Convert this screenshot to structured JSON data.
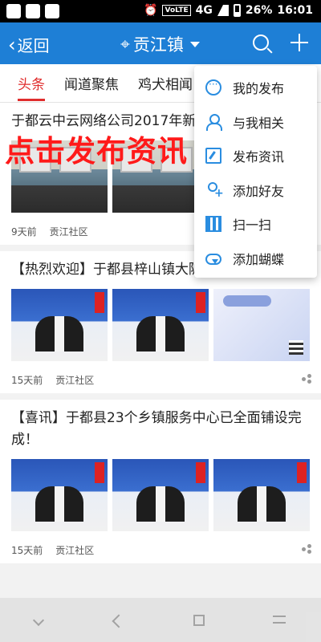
{
  "status_bar": {
    "volte": "VoLTE",
    "network": "4G",
    "battery": "26%",
    "time": "16:01"
  },
  "app_bar": {
    "back_label": "返回",
    "location": "贡江镇"
  },
  "tabs": [
    {
      "label": "头条",
      "active": true
    },
    {
      "label": "闻道聚焦",
      "active": false
    },
    {
      "label": "鸡犬相闻",
      "active": false
    }
  ],
  "overlay_caption": "点击发布资讯",
  "dropdown": {
    "items": [
      {
        "label": "我的发布",
        "icon": "chat-icon"
      },
      {
        "label": "与我相关",
        "icon": "person-icon"
      },
      {
        "label": "发布资讯",
        "icon": "edit-icon"
      },
      {
        "label": "添加好友",
        "icon": "add-friend-icon"
      },
      {
        "label": "扫一扫",
        "icon": "qr-scan-icon"
      },
      {
        "label": "添加蝴蝶",
        "icon": "cloud-upload-icon"
      }
    ]
  },
  "feed": {
    "items": [
      {
        "title": "于都云中云网络公司2017年新",
        "age": "9天前",
        "source": "贡江社区"
      },
      {
        "title": "【热烈欢迎】于都县梓山镇大陂村签约首个云平台",
        "age": "15天前",
        "source": "贡江社区"
      },
      {
        "title": "【喜讯】于都县23个乡镇服务中心已全面铺设完成！",
        "age": "15天前",
        "source": "贡江社区"
      }
    ]
  },
  "colors": {
    "primary": "#1e7fd6",
    "accent_red": "#e02d2d",
    "overlay_red": "#ff1a1a"
  }
}
